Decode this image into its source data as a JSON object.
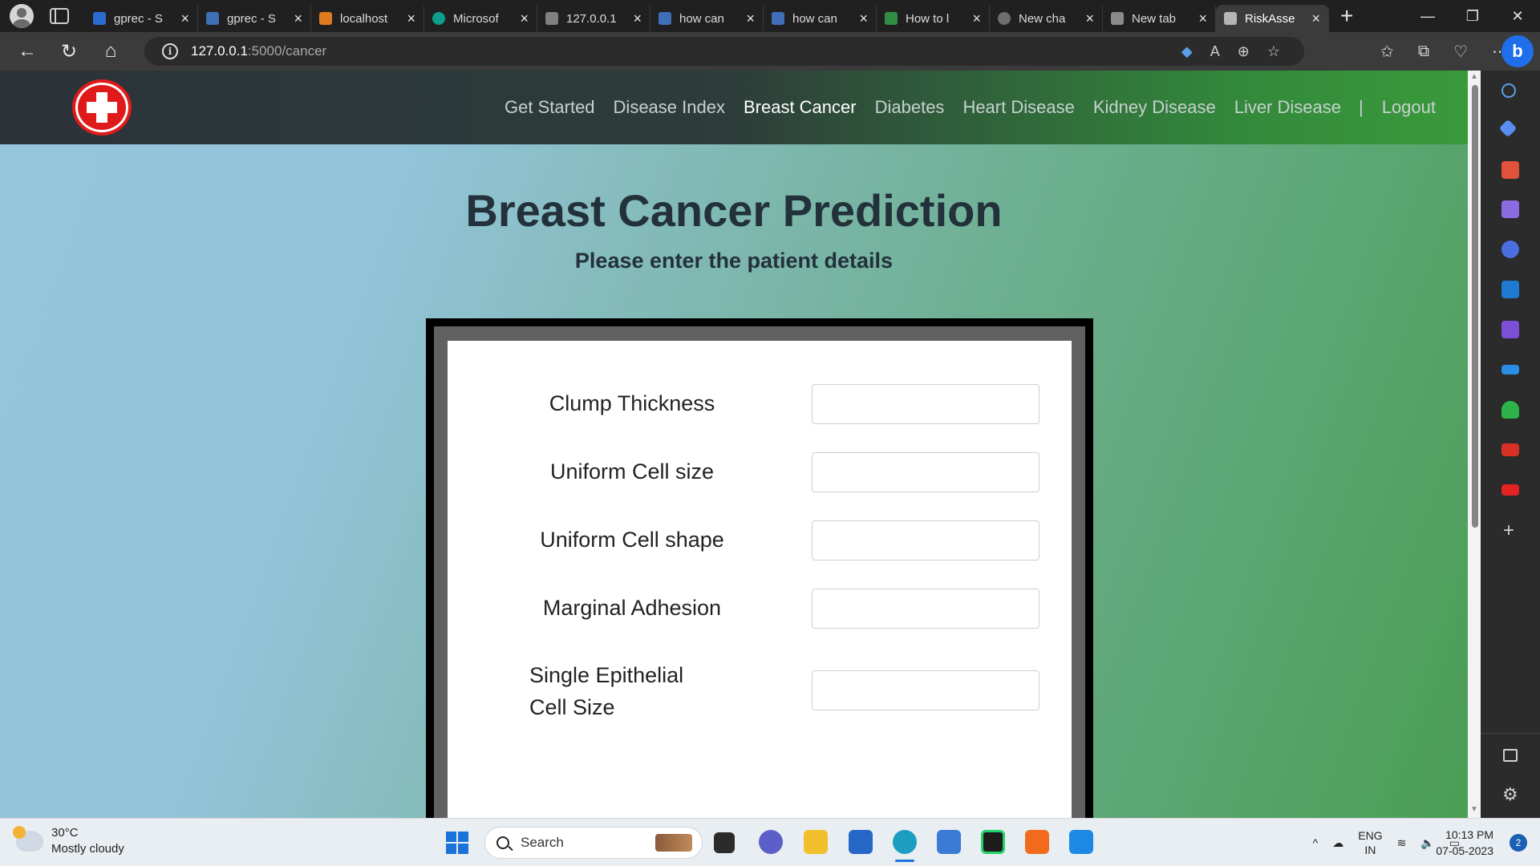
{
  "browser": {
    "tabs": [
      {
        "label": "gprec - S",
        "icon": "bing-icon",
        "color": "#2b6cd1"
      },
      {
        "label": "gprec - S",
        "icon": "search-icon",
        "color": "#3f6fb8"
      },
      {
        "label": "localhost",
        "icon": "localhost-icon",
        "color": "#e07a1f"
      },
      {
        "label": "Microsof",
        "icon": "edge-icon",
        "color": "#0f9d8b"
      },
      {
        "label": "127.0.0.1",
        "icon": "page-icon",
        "color": "#808080"
      },
      {
        "label": "how can",
        "icon": "search-icon",
        "color": "#3f6fb8"
      },
      {
        "label": "how can",
        "icon": "search-icon",
        "color": "#3f6fb8"
      },
      {
        "label": "How to l",
        "icon": "gfg-icon",
        "color": "#2f8d46"
      },
      {
        "label": "New cha",
        "icon": "chatgpt-icon",
        "color": "#6e6e6e"
      },
      {
        "label": "New tab",
        "icon": "newtab-icon",
        "color": "#8a8a8a"
      },
      {
        "label": "RiskAsse",
        "icon": "page-icon",
        "color": "#b5b5b5",
        "active": true
      }
    ],
    "url_host": "127.0.0.1",
    "url_path": ":5000/cancer"
  },
  "site": {
    "nav": {
      "items": [
        "Get Started",
        "Disease Index",
        "Breast Cancer",
        "Diabetes",
        "Heart Disease",
        "Kidney Disease",
        "Liver Disease"
      ],
      "separator": "|",
      "logout": "Logout",
      "current_index": 2
    },
    "title": "Breast Cancer Prediction",
    "subtitle": "Please enter the patient details",
    "form": {
      "fields": [
        {
          "label": "Clump Thickness",
          "value": ""
        },
        {
          "label": "Uniform Cell size",
          "value": ""
        },
        {
          "label": "Uniform Cell shape",
          "value": ""
        },
        {
          "label": "Marginal Adhesion",
          "value": ""
        },
        {
          "label": "Single Epithelial Cell Size",
          "value": ""
        }
      ]
    }
  },
  "taskbar": {
    "weather_temp": "30°C",
    "weather_desc": "Mostly cloudy",
    "search_label": "Search",
    "lang_line1": "ENG",
    "lang_line2": "IN",
    "time": "10:13 PM",
    "date": "07-05-2023",
    "notification_count": "2"
  },
  "colors": {
    "nav_bg_start": "#2c3339",
    "nav_bg_end": "#3a9a3b",
    "page_bg_start": "#94c5db",
    "page_bg_end": "#4b9d55",
    "title_color": "#23313a",
    "logo_red": "#e01a1a"
  }
}
